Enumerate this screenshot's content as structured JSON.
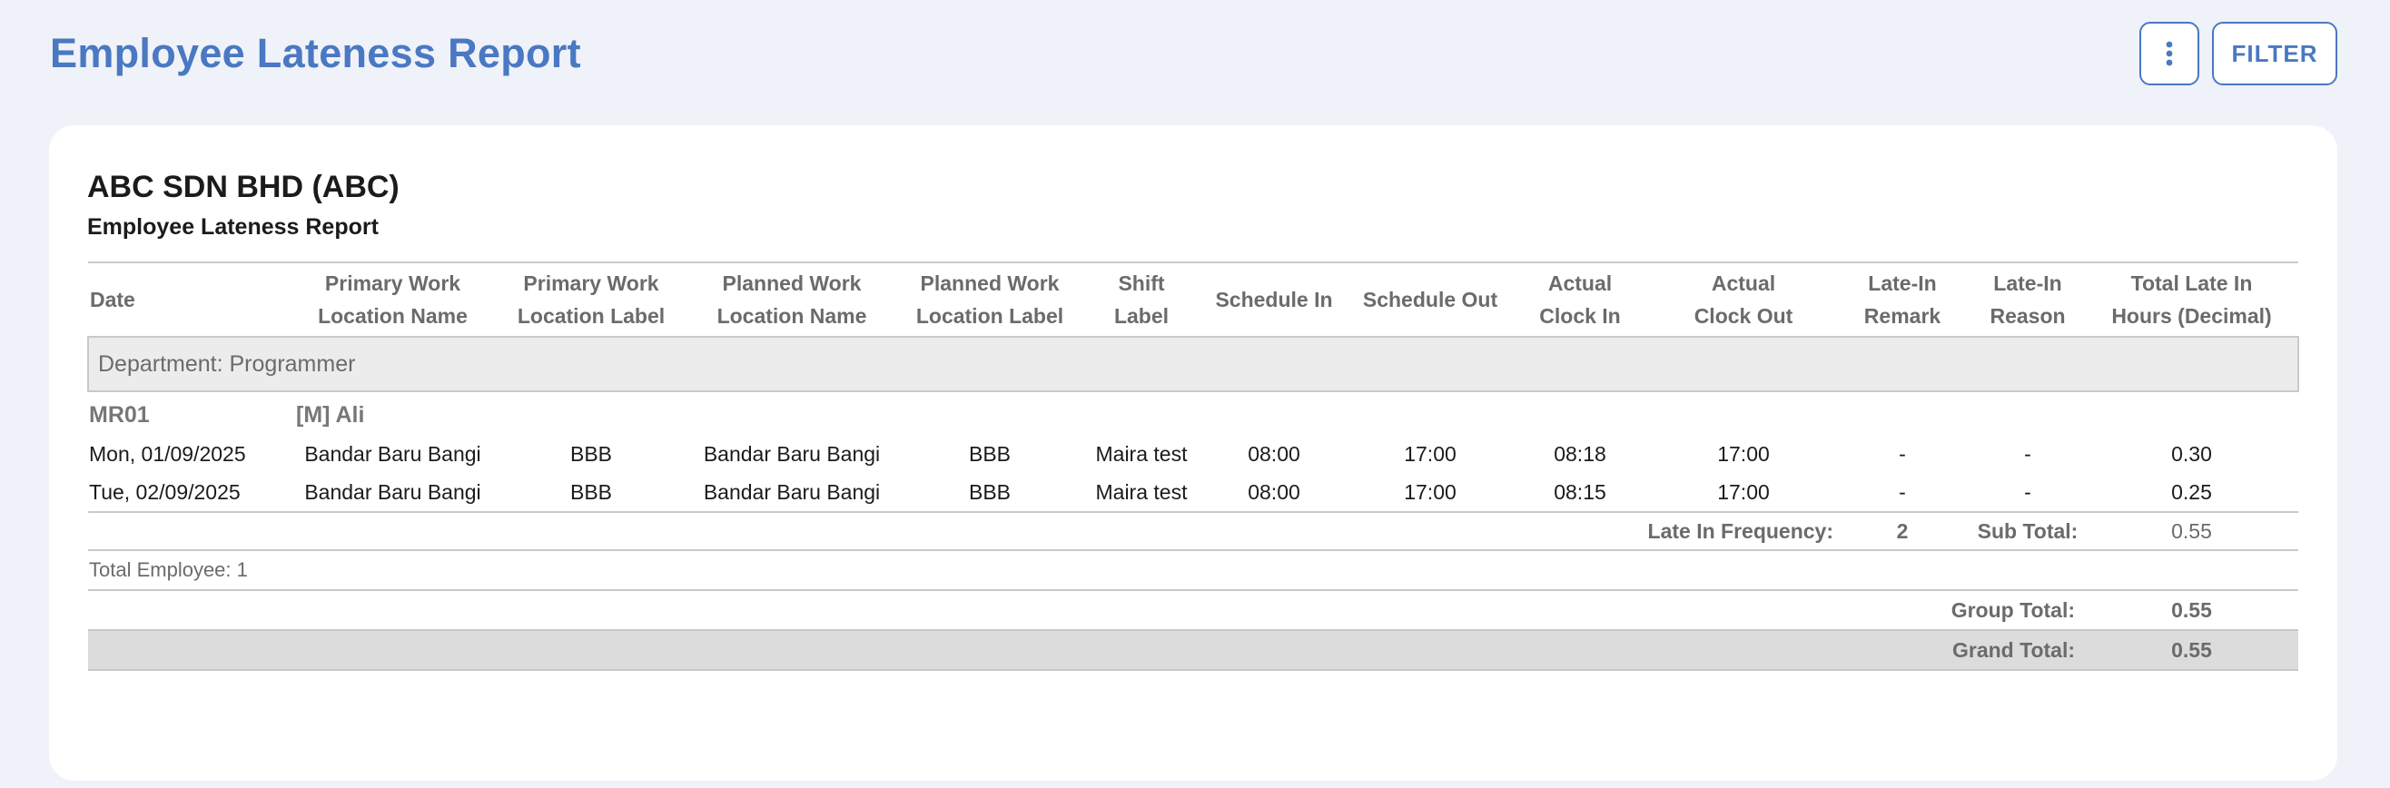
{
  "header": {
    "title": "Employee Lateness Report",
    "more_icon": "vertical-ellipsis-icon",
    "filter_label": "FILTER"
  },
  "colors": {
    "accent": "#4a78c2",
    "background": "#eff2f8",
    "card": "#ffffff",
    "department_band": "#ececec",
    "grand_total_band": "#dcdcdc"
  },
  "report": {
    "company": "ABC SDN BHD (ABC)",
    "subtitle": "Employee Lateness Report",
    "columns": [
      {
        "line1": "Date",
        "line2": ""
      },
      {
        "line1": "Primary Work",
        "line2": "Location Name"
      },
      {
        "line1": "Primary Work",
        "line2": "Location Label"
      },
      {
        "line1": "Planned Work",
        "line2": "Location Name"
      },
      {
        "line1": "Planned Work",
        "line2": "Location Label"
      },
      {
        "line1": "Shift",
        "line2": "Label"
      },
      {
        "line1": "Schedule In",
        "line2": ""
      },
      {
        "line1": "Schedule Out",
        "line2": ""
      },
      {
        "line1": "Actual",
        "line2": "Clock In"
      },
      {
        "line1": "Actual",
        "line2": "Clock Out"
      },
      {
        "line1": "Late-In",
        "line2": "Remark"
      },
      {
        "line1": "Late-In",
        "line2": "Reason"
      },
      {
        "line1": "Total Late In",
        "line2": "Hours (Decimal)"
      }
    ],
    "department": "Department: Programmer",
    "employee": {
      "code": "MR01",
      "name": "[M] Ali"
    },
    "rows": [
      {
        "date": "Mon, 01/09/2025",
        "primary_location_name": "Bandar Baru Bangi",
        "primary_location_label": "BBB",
        "planned_location_name": "Bandar Baru Bangi",
        "planned_location_label": "BBB",
        "shift_label": "Maira test",
        "schedule_in": "08:00",
        "schedule_out": "17:00",
        "actual_in": "08:18",
        "actual_out": "17:00",
        "late_remark": "-",
        "late_reason": "-",
        "late_hours": "0.30"
      },
      {
        "date": "Tue, 02/09/2025",
        "primary_location_name": "Bandar Baru Bangi",
        "primary_location_label": "BBB",
        "planned_location_name": "Bandar Baru Bangi",
        "planned_location_label": "BBB",
        "shift_label": "Maira test",
        "schedule_in": "08:00",
        "schedule_out": "17:00",
        "actual_in": "08:15",
        "actual_out": "17:00",
        "late_remark": "-",
        "late_reason": "-",
        "late_hours": "0.25"
      }
    ],
    "subtotal": {
      "freq_label": "Late In Frequency:",
      "freq_value": "2",
      "label": "Sub Total:",
      "value": "0.55"
    },
    "total_employee": "Total Employee: 1",
    "group_total": {
      "label": "Group Total:",
      "value": "0.55"
    },
    "grand_total": {
      "label": "Grand Total:",
      "value": "0.55"
    }
  }
}
